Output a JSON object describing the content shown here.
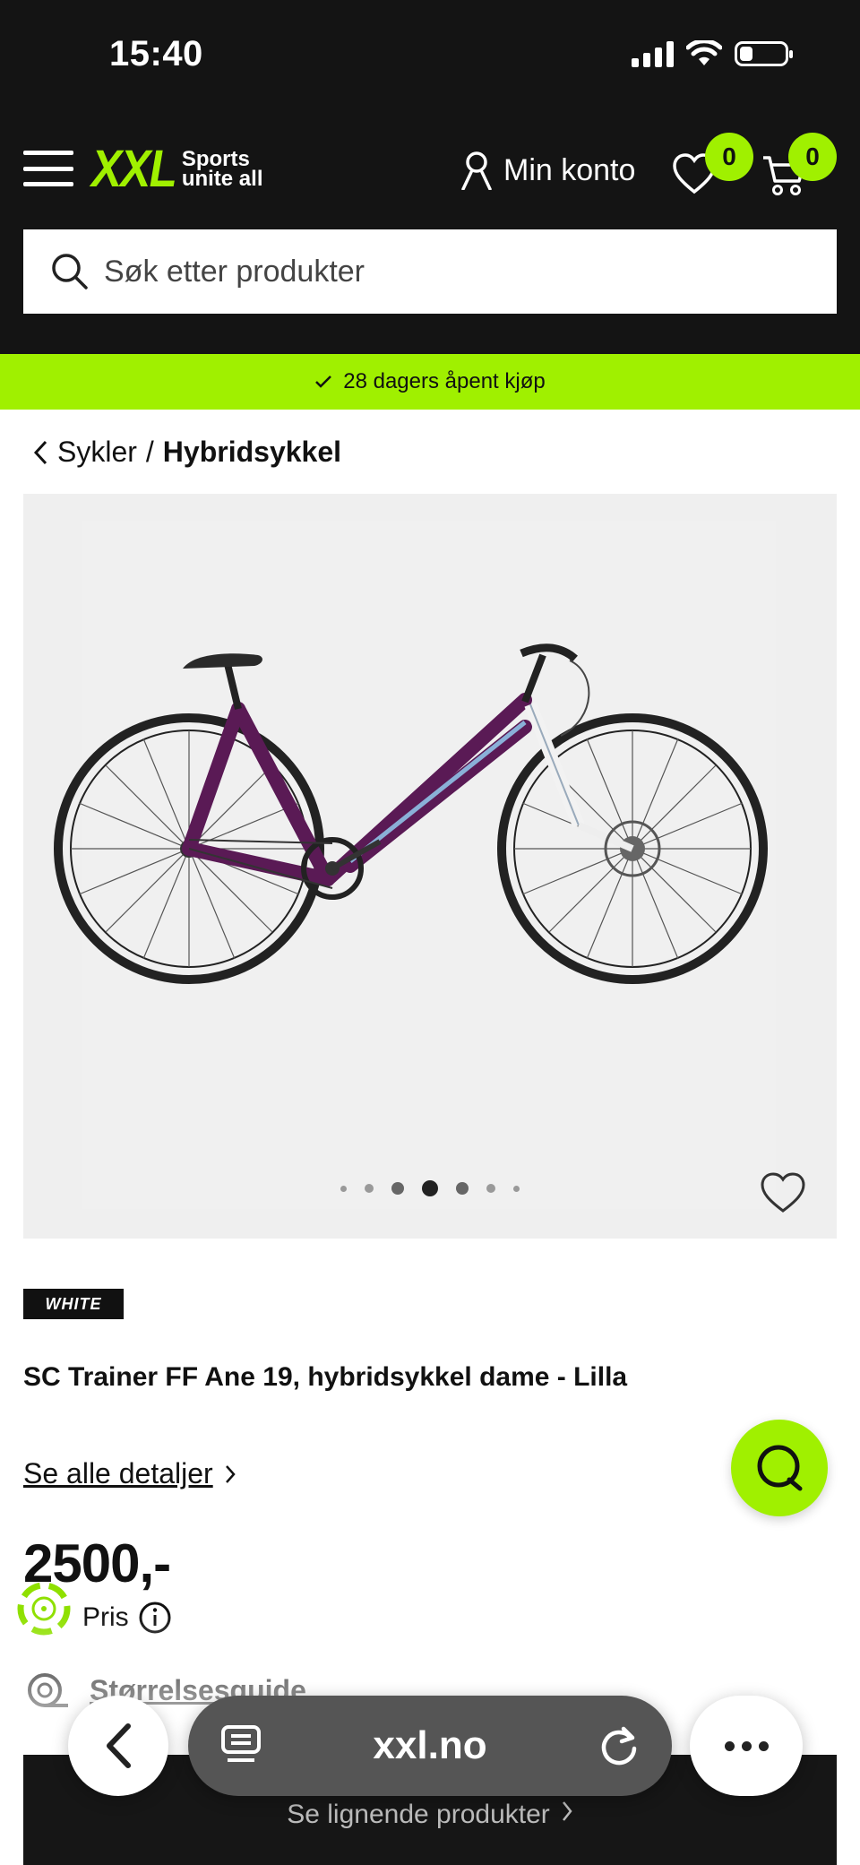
{
  "status_bar": {
    "time": "15:40",
    "battery_level": 0.3
  },
  "header": {
    "logo": {
      "mark": "XXL",
      "tagline_line1": "Sports",
      "tagline_line2": "unite all"
    },
    "account_label": "Min konto",
    "wishlist_count": "0",
    "cart_count": "0"
  },
  "search": {
    "placeholder": "Søk etter produkter"
  },
  "promo": {
    "text": "28 dagers åpent kjøp"
  },
  "breadcrumb": {
    "parent": "Sykler",
    "separator": "/",
    "current": "Hybridsykkel"
  },
  "gallery": {
    "image_count": 7,
    "active_index": 3
  },
  "product": {
    "brand": "WHITE",
    "title": "SC Trainer FF Ane 19, hybridsykkel dame - Lilla",
    "details_link": "Se alle detaljer",
    "price": "2500,-",
    "price_label": "Pris",
    "size_guide": "Størrelsesguide"
  },
  "bottom_cta": {
    "label": "Se lignende produkter"
  },
  "browser": {
    "url": "xxl.no"
  },
  "colors": {
    "accent": "#a0f000",
    "header_bg": "#141414",
    "bike_frame": "#5a1a55"
  }
}
